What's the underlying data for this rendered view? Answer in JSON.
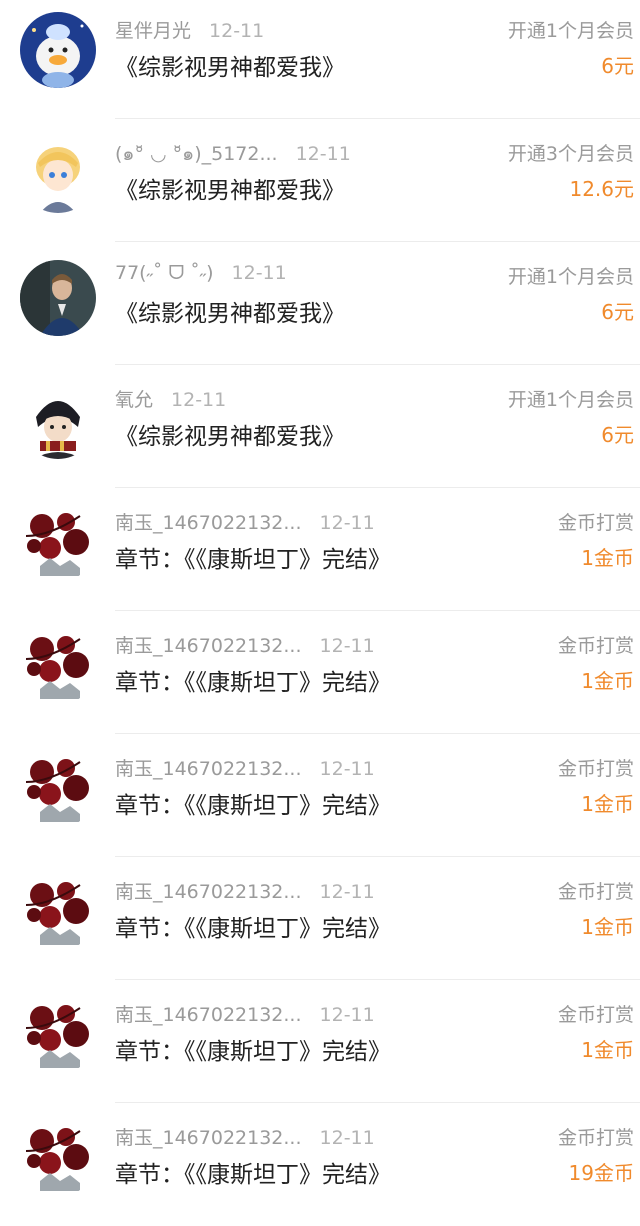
{
  "colors": {
    "accent": "#f08a2c",
    "muted": "#9a9a9a",
    "text": "#222222",
    "divider": "#ececec"
  },
  "records": [
    {
      "avatar_icon": "duck-cartoon-avatar-icon",
      "username": "星伴月光",
      "date": "12-11",
      "title": "《综影视男神都爱我》",
      "action": "开通1个月会员",
      "amount": "6元"
    },
    {
      "avatar_icon": "anime-boy-avatar-icon",
      "username": "(๑°̆ ◡ °̆๑)_5172...",
      "date": "12-11",
      "title": "《综影视男神都爱我》",
      "action": "开通3个月会员",
      "amount": "12.6元"
    },
    {
      "avatar_icon": "man-photo-avatar-icon",
      "username": "77(˶˚ ᗜ ˚˶)",
      "date": "12-11",
      "title": "《综影视男神都爱我》",
      "action": "开通1个月会员",
      "amount": "6元"
    },
    {
      "avatar_icon": "anime-scarf-avatar-icon",
      "username": "氧允",
      "date": "12-11",
      "title": "《综影视男神都爱我》",
      "action": "开通1个月会员",
      "amount": "6元"
    },
    {
      "avatar_icon": "red-flower-avatar-icon",
      "username": "南玉_1467022132...",
      "date": "12-11",
      "title": "章节：《《康斯坦丁》完结》",
      "action": "金币打赏",
      "amount": "1金币"
    },
    {
      "avatar_icon": "red-flower-avatar-icon",
      "username": "南玉_1467022132...",
      "date": "12-11",
      "title": "章节：《《康斯坦丁》完结》",
      "action": "金币打赏",
      "amount": "1金币"
    },
    {
      "avatar_icon": "red-flower-avatar-icon",
      "username": "南玉_1467022132...",
      "date": "12-11",
      "title": "章节：《《康斯坦丁》完结》",
      "action": "金币打赏",
      "amount": "1金币"
    },
    {
      "avatar_icon": "red-flower-avatar-icon",
      "username": "南玉_1467022132...",
      "date": "12-11",
      "title": "章节：《《康斯坦丁》完结》",
      "action": "金币打赏",
      "amount": "1金币"
    },
    {
      "avatar_icon": "red-flower-avatar-icon",
      "username": "南玉_1467022132...",
      "date": "12-11",
      "title": "章节：《《康斯坦丁》完结》",
      "action": "金币打赏",
      "amount": "1金币"
    },
    {
      "avatar_icon": "red-flower-avatar-icon",
      "username": "南玉_1467022132...",
      "date": "12-11",
      "title": "章节：《《康斯坦丁》完结》",
      "action": "金币打赏",
      "amount": "19金币"
    }
  ]
}
